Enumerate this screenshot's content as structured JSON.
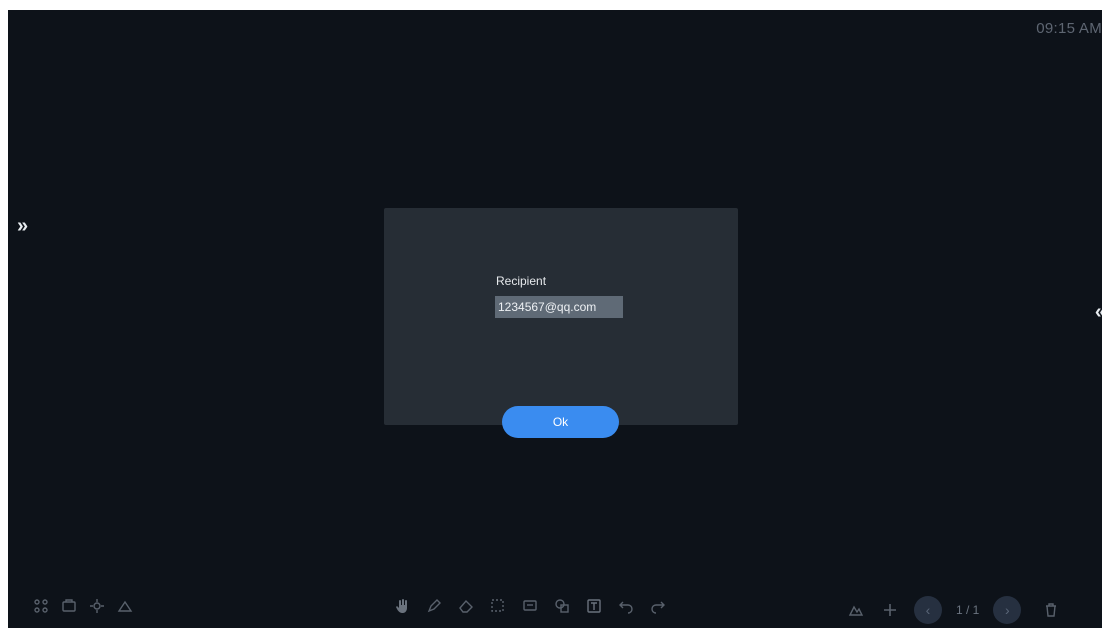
{
  "status": {
    "time": "09:15 AM"
  },
  "dialog": {
    "label": "Recipient",
    "email": "1234567@qq.com",
    "ok_label": "Ok"
  },
  "nav": {
    "left_arrow": "»",
    "right_arrow": "«"
  },
  "pagination": {
    "indicator": "1 / 1"
  }
}
